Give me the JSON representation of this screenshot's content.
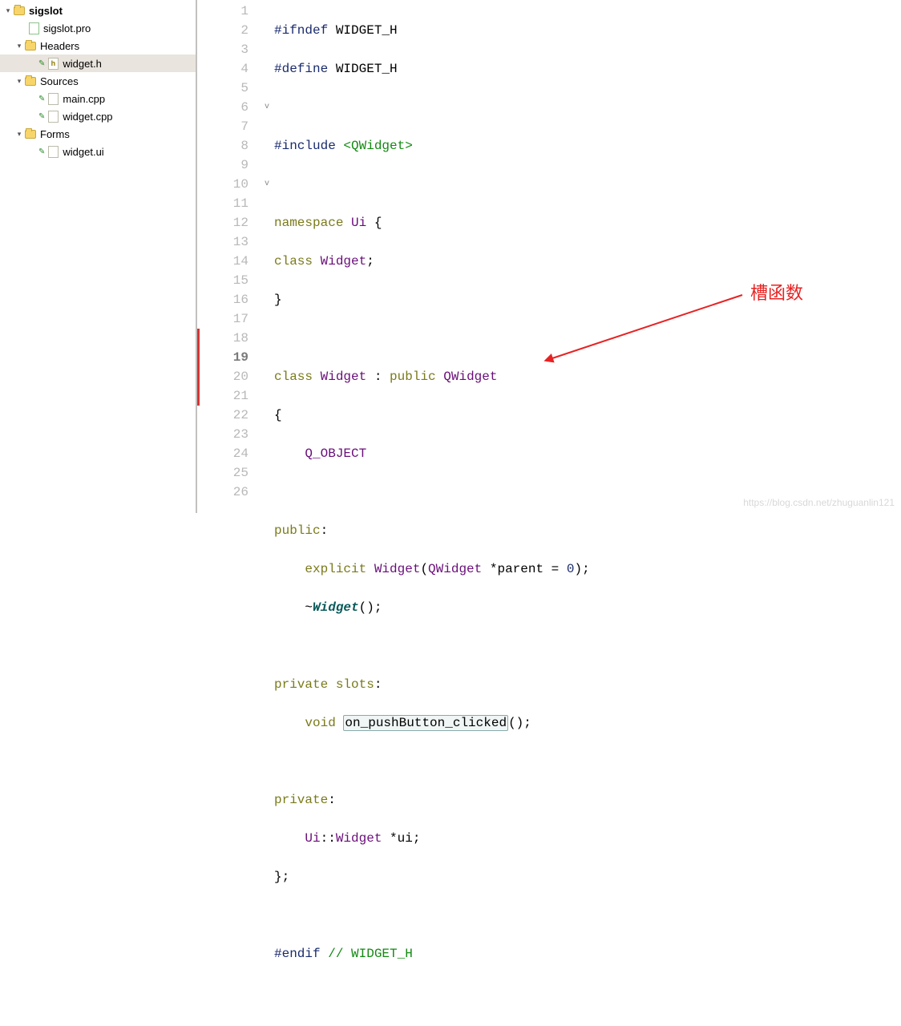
{
  "tree": {
    "root": "sigslot",
    "pro": "sigslot.pro",
    "headers": "Headers",
    "widget_h": "widget.h",
    "sources": "Sources",
    "main_cpp": "main.cpp",
    "widget_cpp": "widget.cpp",
    "forms": "Forms",
    "widget_ui": "widget.ui"
  },
  "annotation": "槽函数",
  "watermark": "https://blog.csdn.net/zhuguanlin121",
  "code": {
    "l1": {
      "pre": "#ifndef ",
      "tok": "WIDGET_H"
    },
    "l2": {
      "pre": "#define ",
      "tok": "WIDGET_H"
    },
    "l4": {
      "pre": "#include ",
      "ang": "<QWidget>"
    },
    "l6": {
      "kw": "namespace",
      "sp": " ",
      "id": "Ui",
      "rest": " {"
    },
    "l7": {
      "kw": "class",
      "sp": " ",
      "id": "Widget",
      "semi": ";"
    },
    "l8": "}",
    "l10": {
      "kw1": "class",
      "sp1": " ",
      "id1": "Widget",
      "sp2": " : ",
      "kw2": "public",
      "sp3": " ",
      "id2": "QWidget"
    },
    "l11": "{",
    "l12": {
      "ind": "    ",
      "mac": "Q_OBJECT"
    },
    "l14": {
      "kw": "public",
      "c": ":"
    },
    "l15": {
      "ind": "    ",
      "kw": "explicit",
      "sp": " ",
      "id": "Widget",
      "open": "(",
      "t": "QWidget",
      "args": " *parent = ",
      "zero": "0",
      "close": ");"
    },
    "l16": {
      "ind": "    ",
      "tilde": "~",
      "dtor": "Widget",
      "rest": "();"
    },
    "l18": {
      "kw1": "private",
      "sp": " ",
      "kw2": "slots",
      "c": ":"
    },
    "l19": {
      "ind": "    ",
      "kw": "void",
      "sp": " ",
      "fn": "on_pushButton_clicked",
      "rest": "();"
    },
    "l21": {
      "kw": "private",
      "c": ":"
    },
    "l22": {
      "ind": "    ",
      "ns": "Ui",
      "cc": "::",
      "cls": "Widget",
      "rest": " *ui;"
    },
    "l23": "};",
    "l25": {
      "pre": "#endif ",
      "cm": "// WIDGET_H"
    }
  },
  "line_numbers": [
    "1",
    "2",
    "3",
    "4",
    "5",
    "6",
    "7",
    "8",
    "9",
    "10",
    "11",
    "12",
    "13",
    "14",
    "15",
    "16",
    "17",
    "18",
    "19",
    "20",
    "21",
    "22",
    "23",
    "24",
    "25",
    "26"
  ],
  "current_line": "19",
  "folds": {
    "6": "v",
    "10": "v"
  },
  "modified_lines": [
    "18",
    "19",
    "20",
    "21"
  ]
}
